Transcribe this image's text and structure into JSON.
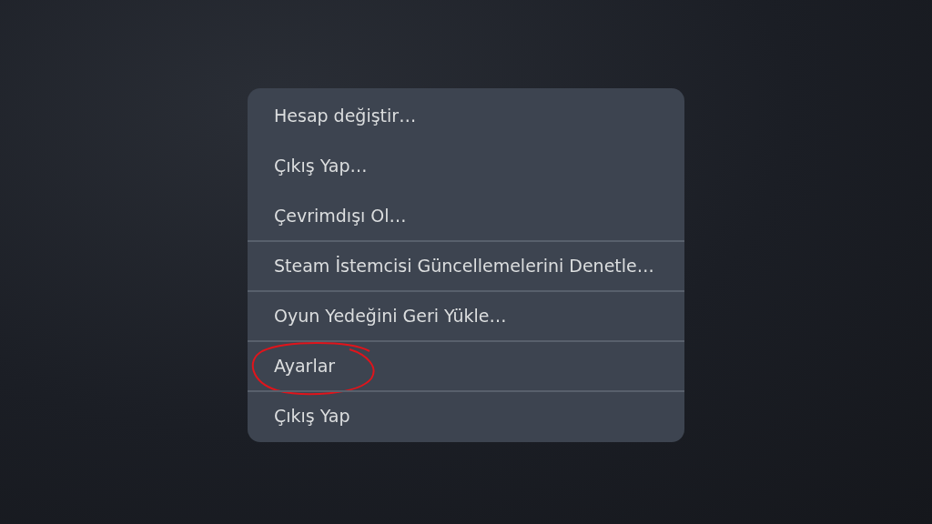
{
  "menu": {
    "items": [
      {
        "label": "Hesap değiştir…",
        "divider_before": false,
        "circled": false
      },
      {
        "label": "Çıkış Yap…",
        "divider_before": false,
        "circled": false
      },
      {
        "label": "Çevrimdışı Ol…",
        "divider_before": false,
        "circled": false
      },
      {
        "label": "Steam İstemcisi Güncellemelerini Denetle…",
        "divider_before": true,
        "circled": false
      },
      {
        "label": "Oyun Yedeğini Geri Yükle…",
        "divider_before": true,
        "circled": false
      },
      {
        "label": "Ayarlar",
        "divider_before": true,
        "circled": true
      },
      {
        "label": "Çıkış Yap",
        "divider_before": true,
        "circled": false
      }
    ]
  }
}
